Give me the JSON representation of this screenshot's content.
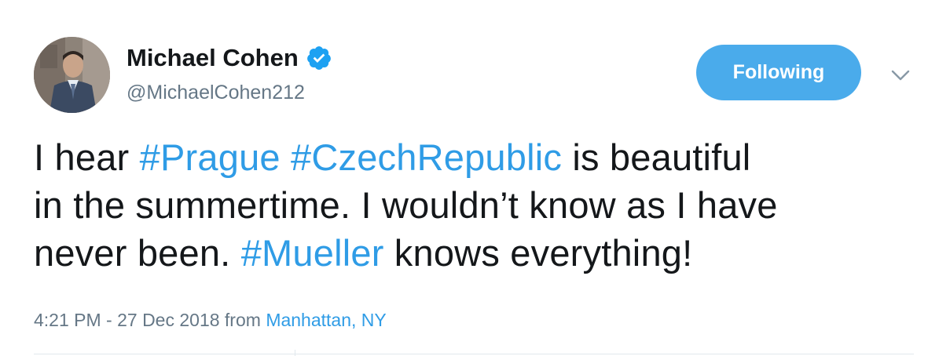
{
  "author": {
    "display_name": "Michael Cohen",
    "handle": "@MichaelCohen212",
    "verified": true
  },
  "actions": {
    "follow_label": "Following",
    "more_icon": "chevron-down-icon"
  },
  "tweet": {
    "lines": [
      [
        {
          "text": "I hear ",
          "type": "text"
        },
        {
          "text": "#Prague",
          "type": "hashtag"
        },
        {
          "text": " ",
          "type": "text"
        },
        {
          "text": "#CzechRepublic",
          "type": "hashtag"
        },
        {
          "text": " is beautiful",
          "type": "text"
        }
      ],
      [
        {
          "text": "in the summertime. I wouldn’t know as I have",
          "type": "text"
        }
      ],
      [
        {
          "text": "never been. ",
          "type": "text"
        },
        {
          "text": "#Mueller",
          "type": "hashtag"
        },
        {
          "text": " knows everything!",
          "type": "text"
        }
      ]
    ]
  },
  "meta": {
    "timestamp": "4:21 PM - 27 Dec 2018",
    "from_label": "from",
    "location": "Manhattan, NY"
  },
  "colors": {
    "accent": "#1da1f2",
    "text": "#14171a",
    "muted": "#657786"
  }
}
